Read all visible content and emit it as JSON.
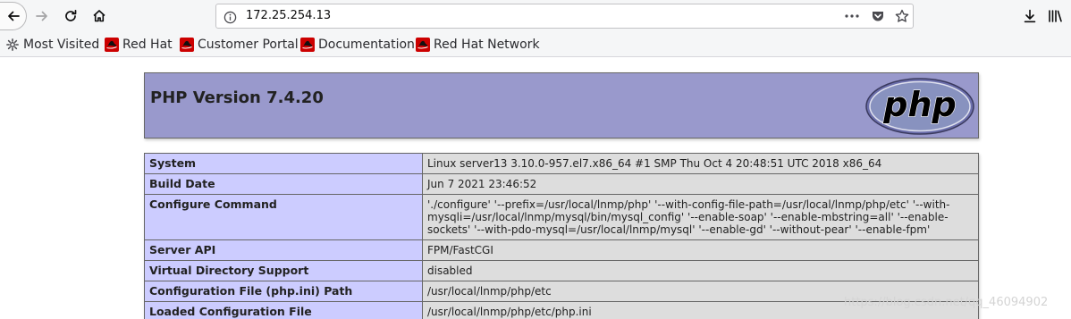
{
  "browser": {
    "url": "172.25.254.13",
    "bookmarks": [
      {
        "label": "Most Visited",
        "icon": "gear-icon"
      },
      {
        "label": "Red Hat",
        "icon": "redhat-icon"
      },
      {
        "label": "Customer Portal",
        "icon": "redhat-icon"
      },
      {
        "label": "Documentation",
        "icon": "redhat-icon"
      },
      {
        "label": "Red Hat Network",
        "icon": "redhat-icon"
      }
    ],
    "icons": [
      "back-arrow-icon",
      "forward-arrow-icon",
      "reload-icon",
      "home-icon",
      "info-icon",
      "more-dots-icon",
      "pocket-icon",
      "star-icon",
      "download-icon",
      "library-icon"
    ]
  },
  "page": {
    "title": "PHP Version 7.4.20",
    "logo_text": "php",
    "rows": [
      {
        "key": "System",
        "value": "Linux server13 3.10.0-957.el7.x86_64 #1 SMP Thu Oct 4 20:48:51 UTC 2018 x86_64"
      },
      {
        "key": "Build Date",
        "value": "Jun 7 2021 23:46:52"
      },
      {
        "key": "Configure Command",
        "value": "'./configure' '--prefix=/usr/local/lnmp/php' '--with-config-file-path=/usr/local/lnmp/php/etc' '--with-mysqli=/usr/local/lnmp/mysql/bin/mysql_config' '--enable-soap' '--enable-mbstring=all' '--enable-sockets' '--with-pdo-mysql=/usr/local/lnmp/mysql' '--enable-gd' '--without-pear' '--enable-fpm'"
      },
      {
        "key": "Server API",
        "value": "FPM/FastCGI"
      },
      {
        "key": "Virtual Directory Support",
        "value": "disabled"
      },
      {
        "key": "Configuration File (php.ini) Path",
        "value": "/usr/local/lnmp/php/etc"
      },
      {
        "key": "Loaded Configuration File",
        "value": "/usr/local/lnmp/php/etc/php.ini"
      }
    ]
  },
  "watermark": "https://blog.csdn.net/qq_46094902",
  "colors": {
    "header_bg": "#9999cc",
    "key_bg": "#ccccff",
    "value_bg": "#dddddd",
    "chrome_bg": "#f5f6f7"
  }
}
